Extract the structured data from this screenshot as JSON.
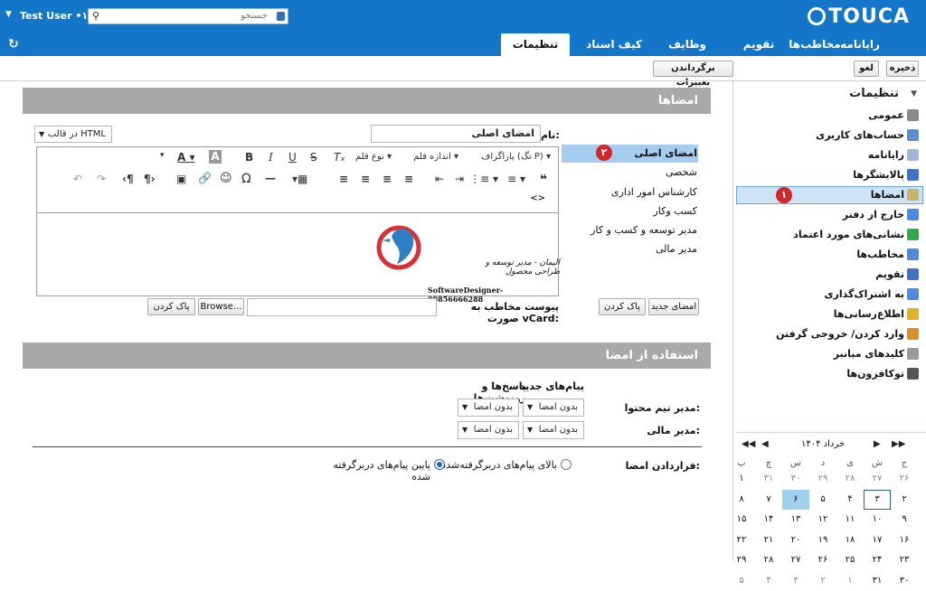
{
  "header": {
    "logo": "TOUCA",
    "user": "Test User •١",
    "search_placeholder": "جستجو",
    "tabs": [
      {
        "label": "رایانامه"
      },
      {
        "label": "مخاطب‌ها"
      },
      {
        "label": "تقویم"
      },
      {
        "label": "وظایف"
      },
      {
        "label": "کیف اسناد"
      },
      {
        "label": "تنظیمات"
      }
    ]
  },
  "toolbar": {
    "save": "ذخیره",
    "cancel": "لغو",
    "revert": "برگرداندن تغییرات"
  },
  "settings_nav": {
    "title": "تنظیمات",
    "items": [
      {
        "label": "عمومی",
        "icon": "gear-icon",
        "color": "#8a8a8a"
      },
      {
        "label": "حساب‌های کاربری",
        "icon": "user-accounts-icon",
        "color": "#5b8fd0"
      },
      {
        "label": "رایانامه",
        "icon": "mail-icon",
        "color": "#9fb8d8"
      },
      {
        "label": "پالایشگرها",
        "icon": "filter-icon",
        "color": "#3f73c8"
      },
      {
        "label": "امضاها",
        "icon": "signature-icon",
        "color": "#c9b46a",
        "selected": true
      },
      {
        "label": "خارج از دفتر",
        "icon": "out-of-office-icon",
        "color": "#4b8be0"
      },
      {
        "label": "نشانی‌های مورد اعتماد",
        "icon": "shield-icon",
        "color": "#35a84a"
      },
      {
        "label": "مخاطب‌ها",
        "icon": "contacts-icon",
        "color": "#4b8be0"
      },
      {
        "label": "تقویم",
        "icon": "calendar-icon",
        "color": "#3f73c8"
      },
      {
        "label": "به اشتراک‌گذاری",
        "icon": "sharing-icon",
        "color": "#4b8be0"
      },
      {
        "label": "اطلاع‌رسانی‌ها",
        "icon": "bell-icon",
        "color": "#e0b02a"
      },
      {
        "label": "وارد کردن/ خروجی گرفتن",
        "icon": "import-export-icon",
        "color": "#d9902a"
      },
      {
        "label": "کلیدهای میانبر",
        "icon": "keyboard-icon",
        "color": "#9a9a9a"
      },
      {
        "label": "توکافزون‌ها",
        "icon": "z-addon-icon",
        "color": "#555555"
      }
    ]
  },
  "calendar": {
    "title": "خرداد ۱۴۰۴",
    "weekdays": [
      "ج",
      "ش",
      "ی",
      "د",
      "س",
      "چ",
      "پ"
    ],
    "rows": [
      [
        "۲۶",
        "۲۷",
        "۲۸",
        "۲۹",
        "۳۰",
        "۳۱",
        "۱"
      ],
      [
        "۲",
        "۳",
        "۴",
        "۵",
        "۶",
        "۷",
        "۸"
      ],
      [
        "۹",
        "۱۰",
        "۱۱",
        "۱۲",
        "۱۳",
        "۱۴",
        "۱۵"
      ],
      [
        "۱۶",
        "۱۷",
        "۱۸",
        "۱۹",
        "۲۰",
        "۲۱",
        "۲۲"
      ],
      [
        "۲۳",
        "۲۴",
        "۲۵",
        "۲۶",
        "۲۷",
        "۲۸",
        "۲۹"
      ],
      [
        "۳۰",
        "۳۱",
        "۱",
        "۲",
        "۳",
        "۴",
        "۵"
      ]
    ],
    "today_color": "#2a5fb0",
    "selected_color": "#9fd0ec"
  },
  "signatures_section": {
    "title": "امضاها",
    "name_label": "نام:",
    "name_value": "امضای اصلی",
    "format_select": "در قالب HTML",
    "signatures": [
      {
        "label": "امضای اصلی",
        "selected": true
      },
      {
        "label": "شخصی"
      },
      {
        "label": "کارشناس امور اداری"
      },
      {
        "label": "کسب وکار"
      },
      {
        "label": "مدیر توسعه و کسب و کار"
      },
      {
        "label": "مدیر مالی"
      }
    ],
    "editor": {
      "paragraph": "پاراگراف (تگ P)",
      "font_size": "اندازه قلم",
      "font_type": "نوع قلم",
      "signature_name_line": "الیمان - مدیر توسعه و طراحی محصول",
      "signature_footer": "SoftwareDesigner-09856666288"
    },
    "vcard_label": "پیوست مخاطب به صورت vCard:",
    "browse": "Browse...",
    "clear": "پاک کردن",
    "new_signature": "امضای جدید",
    "clear2": "پاک کردن",
    "badge1": "۱",
    "badge2": "۲"
  },
  "usage_section": {
    "title": "استفاده از امضا",
    "col_new": "پیام‌های جدید",
    "col_reply": "پاسخ‌ها و رونوشت‌ها",
    "rows": [
      {
        "label": "مدیر تیم محتوا:",
        "new": "بدون امضا",
        "reply": "بدون امضا"
      },
      {
        "label": "مدیر مالی:",
        "new": "بدون امضا",
        "reply": "بدون امضا"
      }
    ],
    "placement_label": "قراردادن امضا:",
    "option_above": "بالای پیام‌های دربرگرفته‌شده",
    "option_below": "پایین پیام‌های دربرگرفته شده",
    "selected_option": "below"
  }
}
